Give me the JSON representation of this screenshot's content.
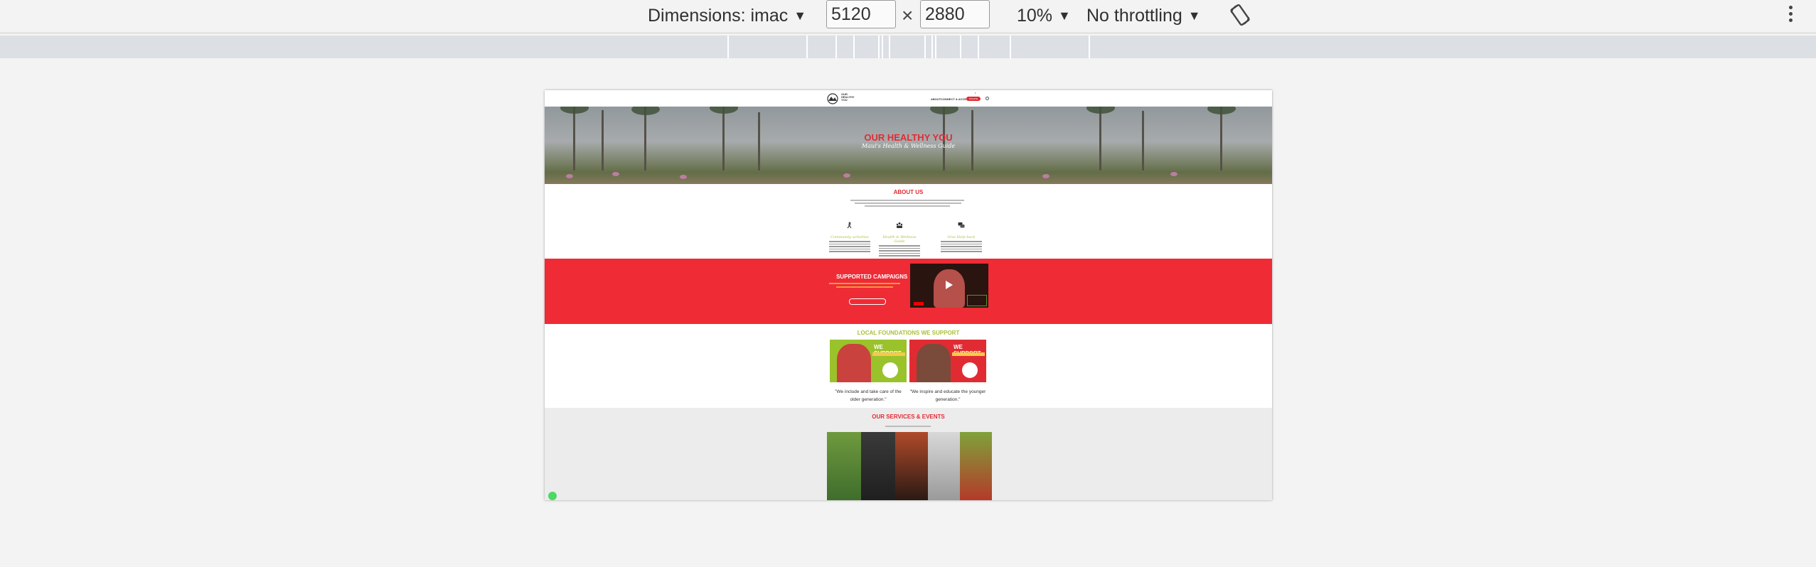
{
  "toolbar": {
    "dimensions_label": "Dimensions: imac",
    "width_value": "5120",
    "times_symbol": "×",
    "height_value": "2880",
    "zoom_label": "10%",
    "throttling_label": "No throttling"
  },
  "site": {
    "logo_text": "OUR HEALTHY YOU",
    "nav": [
      "ABOUT",
      "CONNECT & ACCESS"
    ],
    "nav_cta": "DONATE",
    "hero_title": "OUR HEALTHY YOU",
    "hero_subtitle": "Maui's Health & Wellness Guide",
    "about_title": "ABOUT US",
    "features": [
      "Community activities",
      "Health & Wellness Guide",
      "Give Help back"
    ],
    "campaigns_title": "SUPPORTED CAMPAIGNS",
    "foundations_title": "LOCAL FOUNDATIONS WE SUPPORT",
    "cards": [
      {
        "label": "WE SUPPORT"
      },
      {
        "label": "WE SUPPORT"
      }
    ],
    "quotes": [
      "\"We include and take care of the older generation.\"",
      "\"We inspire and educate the younger generation.\""
    ],
    "services_title": "OUR SERVICES & EVENTS"
  },
  "colors": {
    "brand_red": "#e12b33",
    "brand_green": "#a9c23a"
  }
}
